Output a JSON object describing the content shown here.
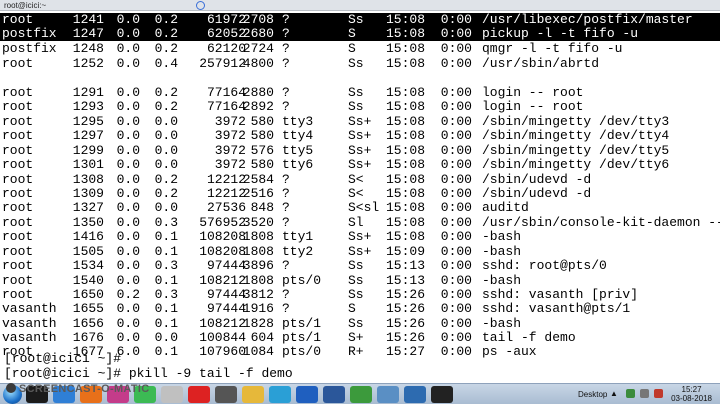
{
  "window": {
    "title": "root@icici:~"
  },
  "process_rows": [
    {
      "user": "root",
      "pid": "1241",
      "cpu": "0.0",
      "mem": "0.2",
      "vsz": "61972",
      "rss": "2708",
      "tty": "?",
      "stat": "Ss",
      "start": "15:08",
      "time": "0:00",
      "command": "/usr/libexec/postfix/master",
      "highlight": true
    },
    {
      "user": "postfix",
      "pid": "1247",
      "cpu": "0.0",
      "mem": "0.2",
      "vsz": "62052",
      "rss": "2680",
      "tty": "?",
      "stat": "S",
      "start": "15:08",
      "time": "0:00",
      "command": "pickup -l -t fifo -u",
      "highlight": true
    },
    {
      "user": "postfix",
      "pid": "1248",
      "cpu": "0.0",
      "mem": "0.2",
      "vsz": "62120",
      "rss": "2724",
      "tty": "?",
      "stat": "S",
      "start": "15:08",
      "time": "0:00",
      "command": "qmgr -l -t fifo -u"
    },
    {
      "user": "root",
      "pid": "1252",
      "cpu": "0.0",
      "mem": "0.4",
      "vsz": "257912",
      "rss": "4800",
      "tty": "?",
      "stat": "Ss",
      "start": "15:08",
      "time": "0:00",
      "command": "/usr/sbin/abrtd"
    },
    {
      "user": "root",
      "pid": "1291",
      "cpu": "0.0",
      "mem": "0.2",
      "vsz": "77164",
      "rss": "2880",
      "tty": "?",
      "stat": "Ss",
      "start": "15:08",
      "time": "0:00",
      "command": "login -- root"
    },
    {
      "user": "root",
      "pid": "1293",
      "cpu": "0.0",
      "mem": "0.2",
      "vsz": "77164",
      "rss": "2892",
      "tty": "?",
      "stat": "Ss",
      "start": "15:08",
      "time": "0:00",
      "command": "login -- root"
    },
    {
      "user": "root",
      "pid": "1295",
      "cpu": "0.0",
      "mem": "0.0",
      "vsz": "3972",
      "rss": "580",
      "tty": "tty3",
      "stat": "Ss+",
      "start": "15:08",
      "time": "0:00",
      "command": "/sbin/mingetty /dev/tty3"
    },
    {
      "user": "root",
      "pid": "1297",
      "cpu": "0.0",
      "mem": "0.0",
      "vsz": "3972",
      "rss": "580",
      "tty": "tty4",
      "stat": "Ss+",
      "start": "15:08",
      "time": "0:00",
      "command": "/sbin/mingetty /dev/tty4"
    },
    {
      "user": "root",
      "pid": "1299",
      "cpu": "0.0",
      "mem": "0.0",
      "vsz": "3972",
      "rss": "576",
      "tty": "tty5",
      "stat": "Ss+",
      "start": "15:08",
      "time": "0:00",
      "command": "/sbin/mingetty /dev/tty5"
    },
    {
      "user": "root",
      "pid": "1301",
      "cpu": "0.0",
      "mem": "0.0",
      "vsz": "3972",
      "rss": "580",
      "tty": "tty6",
      "stat": "Ss+",
      "start": "15:08",
      "time": "0:00",
      "command": "/sbin/mingetty /dev/tty6"
    },
    {
      "user": "root",
      "pid": "1308",
      "cpu": "0.0",
      "mem": "0.2",
      "vsz": "12212",
      "rss": "2584",
      "tty": "?",
      "stat": "S<",
      "start": "15:08",
      "time": "0:00",
      "command": "/sbin/udevd -d"
    },
    {
      "user": "root",
      "pid": "1309",
      "cpu": "0.0",
      "mem": "0.2",
      "vsz": "12212",
      "rss": "2516",
      "tty": "?",
      "stat": "S<",
      "start": "15:08",
      "time": "0:00",
      "command": "/sbin/udevd -d"
    },
    {
      "user": "root",
      "pid": "1327",
      "cpu": "0.0",
      "mem": "0.0",
      "vsz": "27536",
      "rss": "848",
      "tty": "?",
      "stat": "S<sl",
      "start": "15:08",
      "time": "0:00",
      "command": "auditd"
    },
    {
      "user": "root",
      "pid": "1350",
      "cpu": "0.0",
      "mem": "0.3",
      "vsz": "576952",
      "rss": "3520",
      "tty": "?",
      "stat": "Sl",
      "start": "15:08",
      "time": "0:00",
      "command": "/usr/sbin/console-kit-daemon --"
    },
    {
      "user": "root",
      "pid": "1416",
      "cpu": "0.0",
      "mem": "0.1",
      "vsz": "108208",
      "rss": "1808",
      "tty": "tty1",
      "stat": "Ss+",
      "start": "15:08",
      "time": "0:00",
      "command": "-bash"
    },
    {
      "user": "root",
      "pid": "1505",
      "cpu": "0.0",
      "mem": "0.1",
      "vsz": "108208",
      "rss": "1808",
      "tty": "tty2",
      "stat": "Ss+",
      "start": "15:09",
      "time": "0:00",
      "command": "-bash"
    },
    {
      "user": "root",
      "pid": "1534",
      "cpu": "0.0",
      "mem": "0.3",
      "vsz": "97444",
      "rss": "3896",
      "tty": "?",
      "stat": "Ss",
      "start": "15:13",
      "time": "0:00",
      "command": "sshd: root@pts/0"
    },
    {
      "user": "root",
      "pid": "1540",
      "cpu": "0.0",
      "mem": "0.1",
      "vsz": "108212",
      "rss": "1808",
      "tty": "pts/0",
      "stat": "Ss",
      "start": "15:13",
      "time": "0:00",
      "command": "-bash"
    },
    {
      "user": "root",
      "pid": "1650",
      "cpu": "0.2",
      "mem": "0.3",
      "vsz": "97444",
      "rss": "3812",
      "tty": "?",
      "stat": "Ss",
      "start": "15:26",
      "time": "0:00",
      "command": "sshd: vasanth [priv]"
    },
    {
      "user": "vasanth",
      "pid": "1655",
      "cpu": "0.0",
      "mem": "0.1",
      "vsz": "97444",
      "rss": "1916",
      "tty": "?",
      "stat": "S",
      "start": "15:26",
      "time": "0:00",
      "command": "sshd: vasanth@pts/1"
    },
    {
      "user": "vasanth",
      "pid": "1656",
      "cpu": "0.0",
      "mem": "0.1",
      "vsz": "108212",
      "rss": "1828",
      "tty": "pts/1",
      "stat": "Ss",
      "start": "15:26",
      "time": "0:00",
      "command": "-bash"
    },
    {
      "user": "vasanth",
      "pid": "1676",
      "cpu": "0.0",
      "mem": "0.0",
      "vsz": "100844",
      "rss": "604",
      "tty": "pts/1",
      "stat": "S+",
      "start": "15:26",
      "time": "0:00",
      "command": "tail -f demo"
    },
    {
      "user": "root",
      "pid": "1677",
      "cpu": "6.0",
      "mem": "0.1",
      "vsz": "107960",
      "rss": "1084",
      "tty": "pts/0",
      "stat": "R+",
      "start": "15:27",
      "time": "0:00",
      "command": "ps -aux"
    }
  ],
  "prompts": [
    "[root@icici ~]#",
    "[root@icici ~]# pkill -9 tail -f demo"
  ],
  "watermark": {
    "text": "SCREENCAST-O-MATIC"
  },
  "taskbar": {
    "icons": [
      "windows-start-icon",
      "cmd-icon",
      "ie-icon",
      "firefox-icon",
      "itunes-icon",
      "chrome-icon",
      "media-icon",
      "remote-icon",
      "folder-icon",
      "player-icon",
      "explorer-icon",
      "outlook-icon",
      "word-icon",
      "torrent-icon",
      "vmware-icon",
      "virtualbox-icon",
      "terminal-icon"
    ],
    "tray_label": "Desktop",
    "clock_time": "15:27",
    "clock_date": "03-08-2018"
  },
  "colors": {
    "terminal_bg": "#ffffff",
    "terminal_fg": "#000000",
    "highlight_bg": "#000000",
    "highlight_fg": "#ffffff"
  }
}
